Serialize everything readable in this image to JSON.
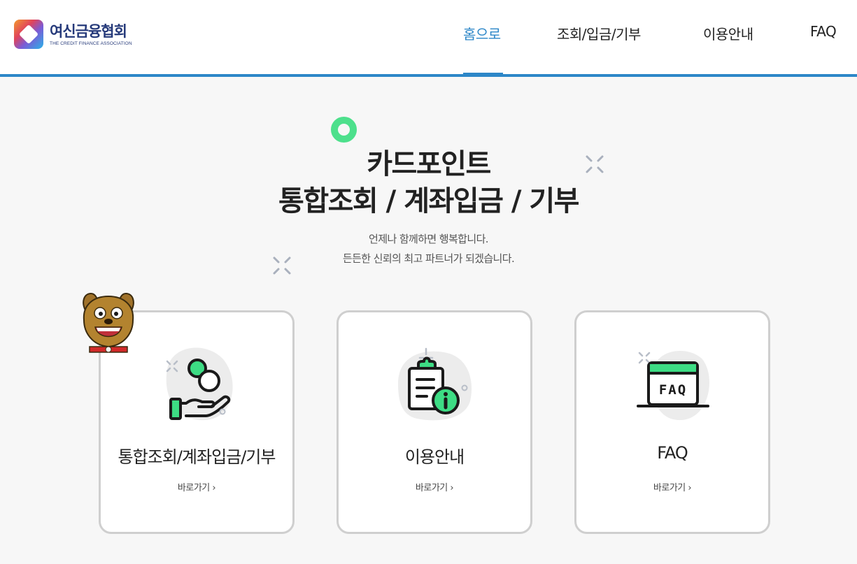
{
  "header": {
    "logo_ko": "여신금융협회",
    "logo_en": "THE CREDIT FINANCE ASSOCIATION",
    "nav": [
      {
        "label": "홈으로",
        "active": true
      },
      {
        "label": "조회/입금/기부",
        "active": false
      },
      {
        "label": "이용안내",
        "active": false
      },
      {
        "label": "FAQ",
        "active": false
      }
    ]
  },
  "hero": {
    "title_line1": "카드포인트",
    "title_line2": "통합조회 / 계좌입금 / 기부",
    "sub_line1": "언제나 함께하면 행복합니다.",
    "sub_line2": "든든한 신뢰의 최고 파트너가 되겠습니다."
  },
  "cards": [
    {
      "title": "통합조회/계좌입금/기부",
      "link": "바로가기 ›",
      "icon": "hand-coins-icon"
    },
    {
      "title": "이용안내",
      "link": "바로가기 ›",
      "icon": "clipboard-info-icon"
    },
    {
      "title": "FAQ",
      "link": "바로가기 ›",
      "icon": "faq-window-icon",
      "icon_text": "FAQ"
    }
  ],
  "colors": {
    "accent": "#2d87c8",
    "green": "#3ddc84",
    "logo_navy": "#263a7a"
  }
}
